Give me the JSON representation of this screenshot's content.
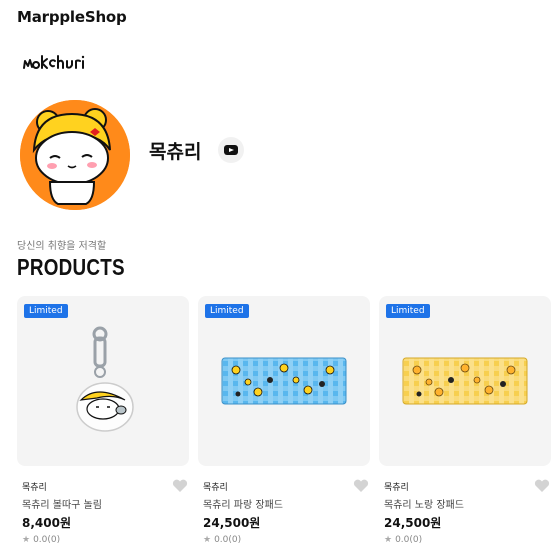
{
  "header": {
    "site_name": "MarppleShop"
  },
  "creator": {
    "logo_text": "mokchuri",
    "name": "목츄리",
    "social_icon": "youtube-icon"
  },
  "section": {
    "tagline": "당신의 취향을 저격할",
    "title": "PRODUCTS"
  },
  "products": [
    {
      "badge": "Limited",
      "brand": "목츄리",
      "title": "목츄리 볼따구 놀림",
      "price": "8,400원",
      "rating": "0.0(0)",
      "image": "acrylic keychain"
    },
    {
      "badge": "Limited",
      "brand": "목츄리",
      "title": "목츄리 파랑 장패드",
      "price": "24,500원",
      "rating": "0.0(0)",
      "image": "blue checkered desk pad"
    },
    {
      "badge": "Limited",
      "brand": "목츄리",
      "title": "목츄리 노랑 장패드",
      "price": "24,500원",
      "rating": "0.0(0)",
      "image": "yellow checkered desk pad"
    }
  ],
  "colors": {
    "badge": "#1e73e8",
    "avatar_bg": "#ff8a1a",
    "pad_blue": "#59b7ee",
    "pad_yellow": "#f7cf4f"
  }
}
